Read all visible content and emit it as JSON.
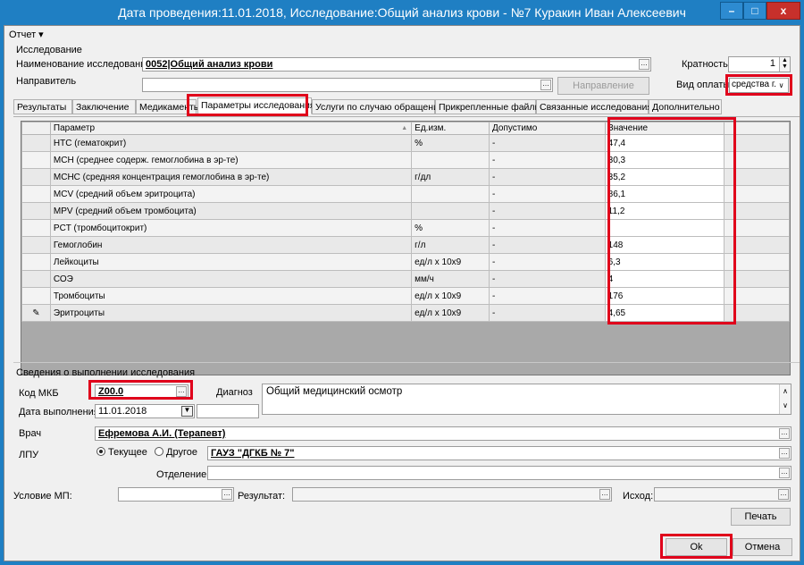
{
  "window": {
    "title": "Дата проведения:11.01.2018, Исследование:Общий  анализ крови - №7 Куракин Иван Алексеевич",
    "minimize": "–",
    "maximize": "□",
    "close": "x"
  },
  "menu": {
    "report": "Отчет ▾"
  },
  "study": {
    "group_label": "Исследование",
    "name_label": "Наименование исследования",
    "name_value": "0052|Общий  анализ крови",
    "multiplicity_label": "Кратность",
    "multiplicity_value": "1",
    "direct_label": "Направитель",
    "direct_value": "",
    "direction_button": "Направление",
    "payment_label": "Вид оплаты",
    "payment_value": "средства г."
  },
  "tabs": [
    "Результаты",
    "Заключение",
    "Медикаменты",
    "Параметры исследования",
    "Услуги по случаю обращения",
    "Прикрепленные файлы",
    "Связанные исследования",
    "Дополнительно"
  ],
  "grid": {
    "headers": {
      "param": "Параметр",
      "unit": "Ед.изм.",
      "allowed": "Допустимо",
      "value": "Значение"
    },
    "rows": [
      {
        "param": "HTC (гематокрит)",
        "unit": "%",
        "allowed": "-",
        "value": "47,4"
      },
      {
        "param": "MCH (среднее содерж. гемоглобина в эр-те)",
        "unit": "",
        "allowed": "-",
        "value": "30,3"
      },
      {
        "param": "MCHC (средняя концентрация гемоглобина в эр-те)",
        "unit": "г/дл",
        "allowed": "-",
        "value": "35,2"
      },
      {
        "param": "MCV (средний объем эритроцита)",
        "unit": "",
        "allowed": "-",
        "value": "86,1"
      },
      {
        "param": "MPV (средний объем тромбоцита)",
        "unit": "",
        "allowed": "-",
        "value": "11,2"
      },
      {
        "param": "PCT (тромбоцитокрит)",
        "unit": "%",
        "allowed": "-",
        "value": ""
      },
      {
        "param": "Гемоглобин",
        "unit": "г/л",
        "allowed": "-",
        "value": "148"
      },
      {
        "param": "Лейкоциты",
        "unit": "ед/л x 10x9",
        "allowed": "-",
        "value": "6,3"
      },
      {
        "param": "СОЭ",
        "unit": "мм/ч",
        "allowed": "-",
        "value": "4"
      },
      {
        "param": "Тромбоциты",
        "unit": "ед/л x 10x9",
        "allowed": "-",
        "value": "176"
      },
      {
        "param": "Эритроциты",
        "unit": "ед/л x 10x9",
        "allowed": "-",
        "value": "4,65"
      }
    ]
  },
  "execution": {
    "group_label": "Сведения о выполнении исследования",
    "mkb_label": "Код МКБ",
    "mkb_value": "Z00.0",
    "diagnosis_label": "Диагноз",
    "diagnosis_value": "Общий медицинский осмотр",
    "date_label": "Дата выполнения",
    "date_value": "11.01.2018",
    "doctor_label": "Врач",
    "doctor_value": "Ефремова А.И. (Терапевт)",
    "lpu_label": "ЛПУ",
    "radio_current": "Текущее",
    "radio_other": "Другое",
    "lpu_value": "ГАУЗ \"ДГКБ № 7\"",
    "department_label": "Отделение",
    "department_value": ""
  },
  "bottom": {
    "condition_label": "Условие МП:",
    "result_label": "Результат:",
    "outcome_label": "Исход:",
    "print_button": "Печать",
    "ok_button": "Ok",
    "cancel_button": "Отмена"
  }
}
